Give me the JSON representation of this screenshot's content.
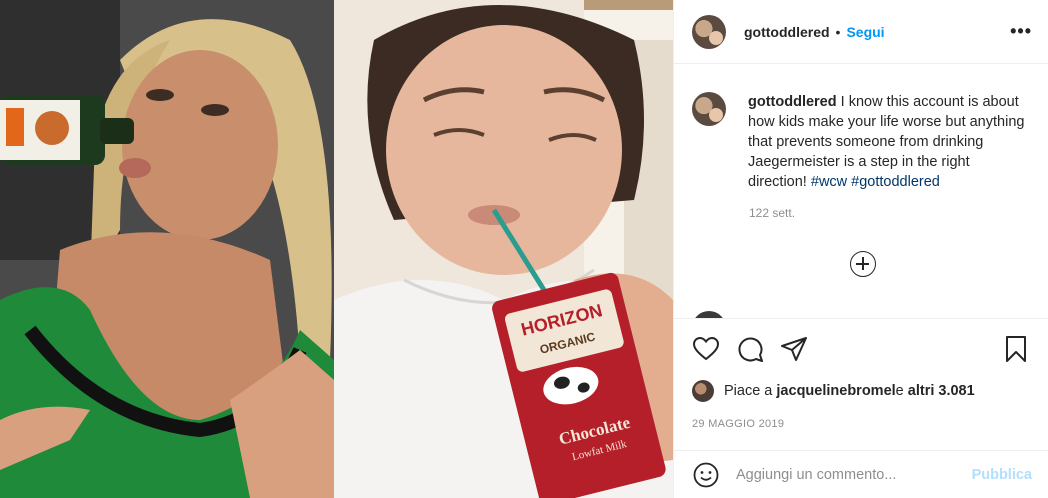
{
  "post": {
    "username": "gottoddlered",
    "follow_label": "Segui",
    "separator": "•",
    "more_label": "•••"
  },
  "media": {
    "left_bottle_label": "Jägermeister",
    "right_carton_brand": "HORIZON",
    "right_carton_sub": "ORGANIC",
    "right_carton_flavor": "Chocolate",
    "right_carton_flavor2": "Lowfat Milk"
  },
  "caption": {
    "username": "gottoddlered",
    "text": " I know this account is about how kids make your life worse but anything that prevents someone from drinking Jaegermeister is a step in the right direction! ",
    "tags": [
      "#wcw",
      "#gottoddlered"
    ],
    "age": "122 sett."
  },
  "likes": {
    "prefix": "Piace a ",
    "user": "jacquelinebromel",
    "middle": " e ",
    "others": "altri 3.081"
  },
  "date": "29 MAGGIO 2019",
  "comment_box": {
    "placeholder": "Aggiungi un commento...",
    "publish_label": "Pubblica"
  },
  "icons": {
    "like": "heart-icon",
    "comment": "speech-bubble-icon",
    "share": "paper-plane-icon",
    "save": "bookmark-icon",
    "emoji": "smiley-icon",
    "load_more": "plus-circle-icon"
  }
}
